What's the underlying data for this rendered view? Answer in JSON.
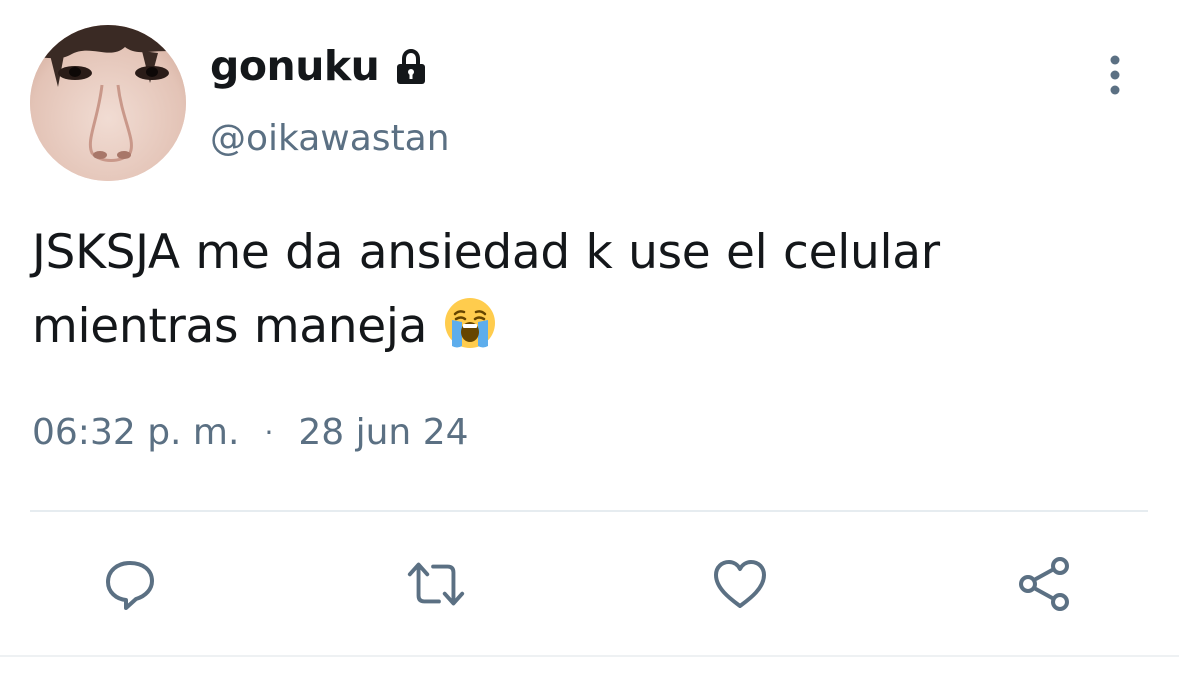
{
  "author": {
    "display_name": "gonuku",
    "handle": "@oikawastan",
    "locked_icon": "lock-icon",
    "avatar_icon": "avatar-photo"
  },
  "tweet": {
    "text_line1": "JSKSJA me da ansiedad k use el celular",
    "text_line2": "mientras maneja",
    "emoji": "loudly-crying-face"
  },
  "meta": {
    "time": "06:32 p. m.",
    "separator": "·",
    "date": "28 jun 24"
  },
  "actions": [
    {
      "icon": "reply-icon"
    },
    {
      "icon": "retweet-icon"
    },
    {
      "icon": "like-icon"
    },
    {
      "icon": "share-icon"
    }
  ],
  "more_icon": "more-vertical-icon",
  "colors": {
    "text": "#14171a",
    "secondary": "#5b7083",
    "divider": "#e6ecf0"
  }
}
